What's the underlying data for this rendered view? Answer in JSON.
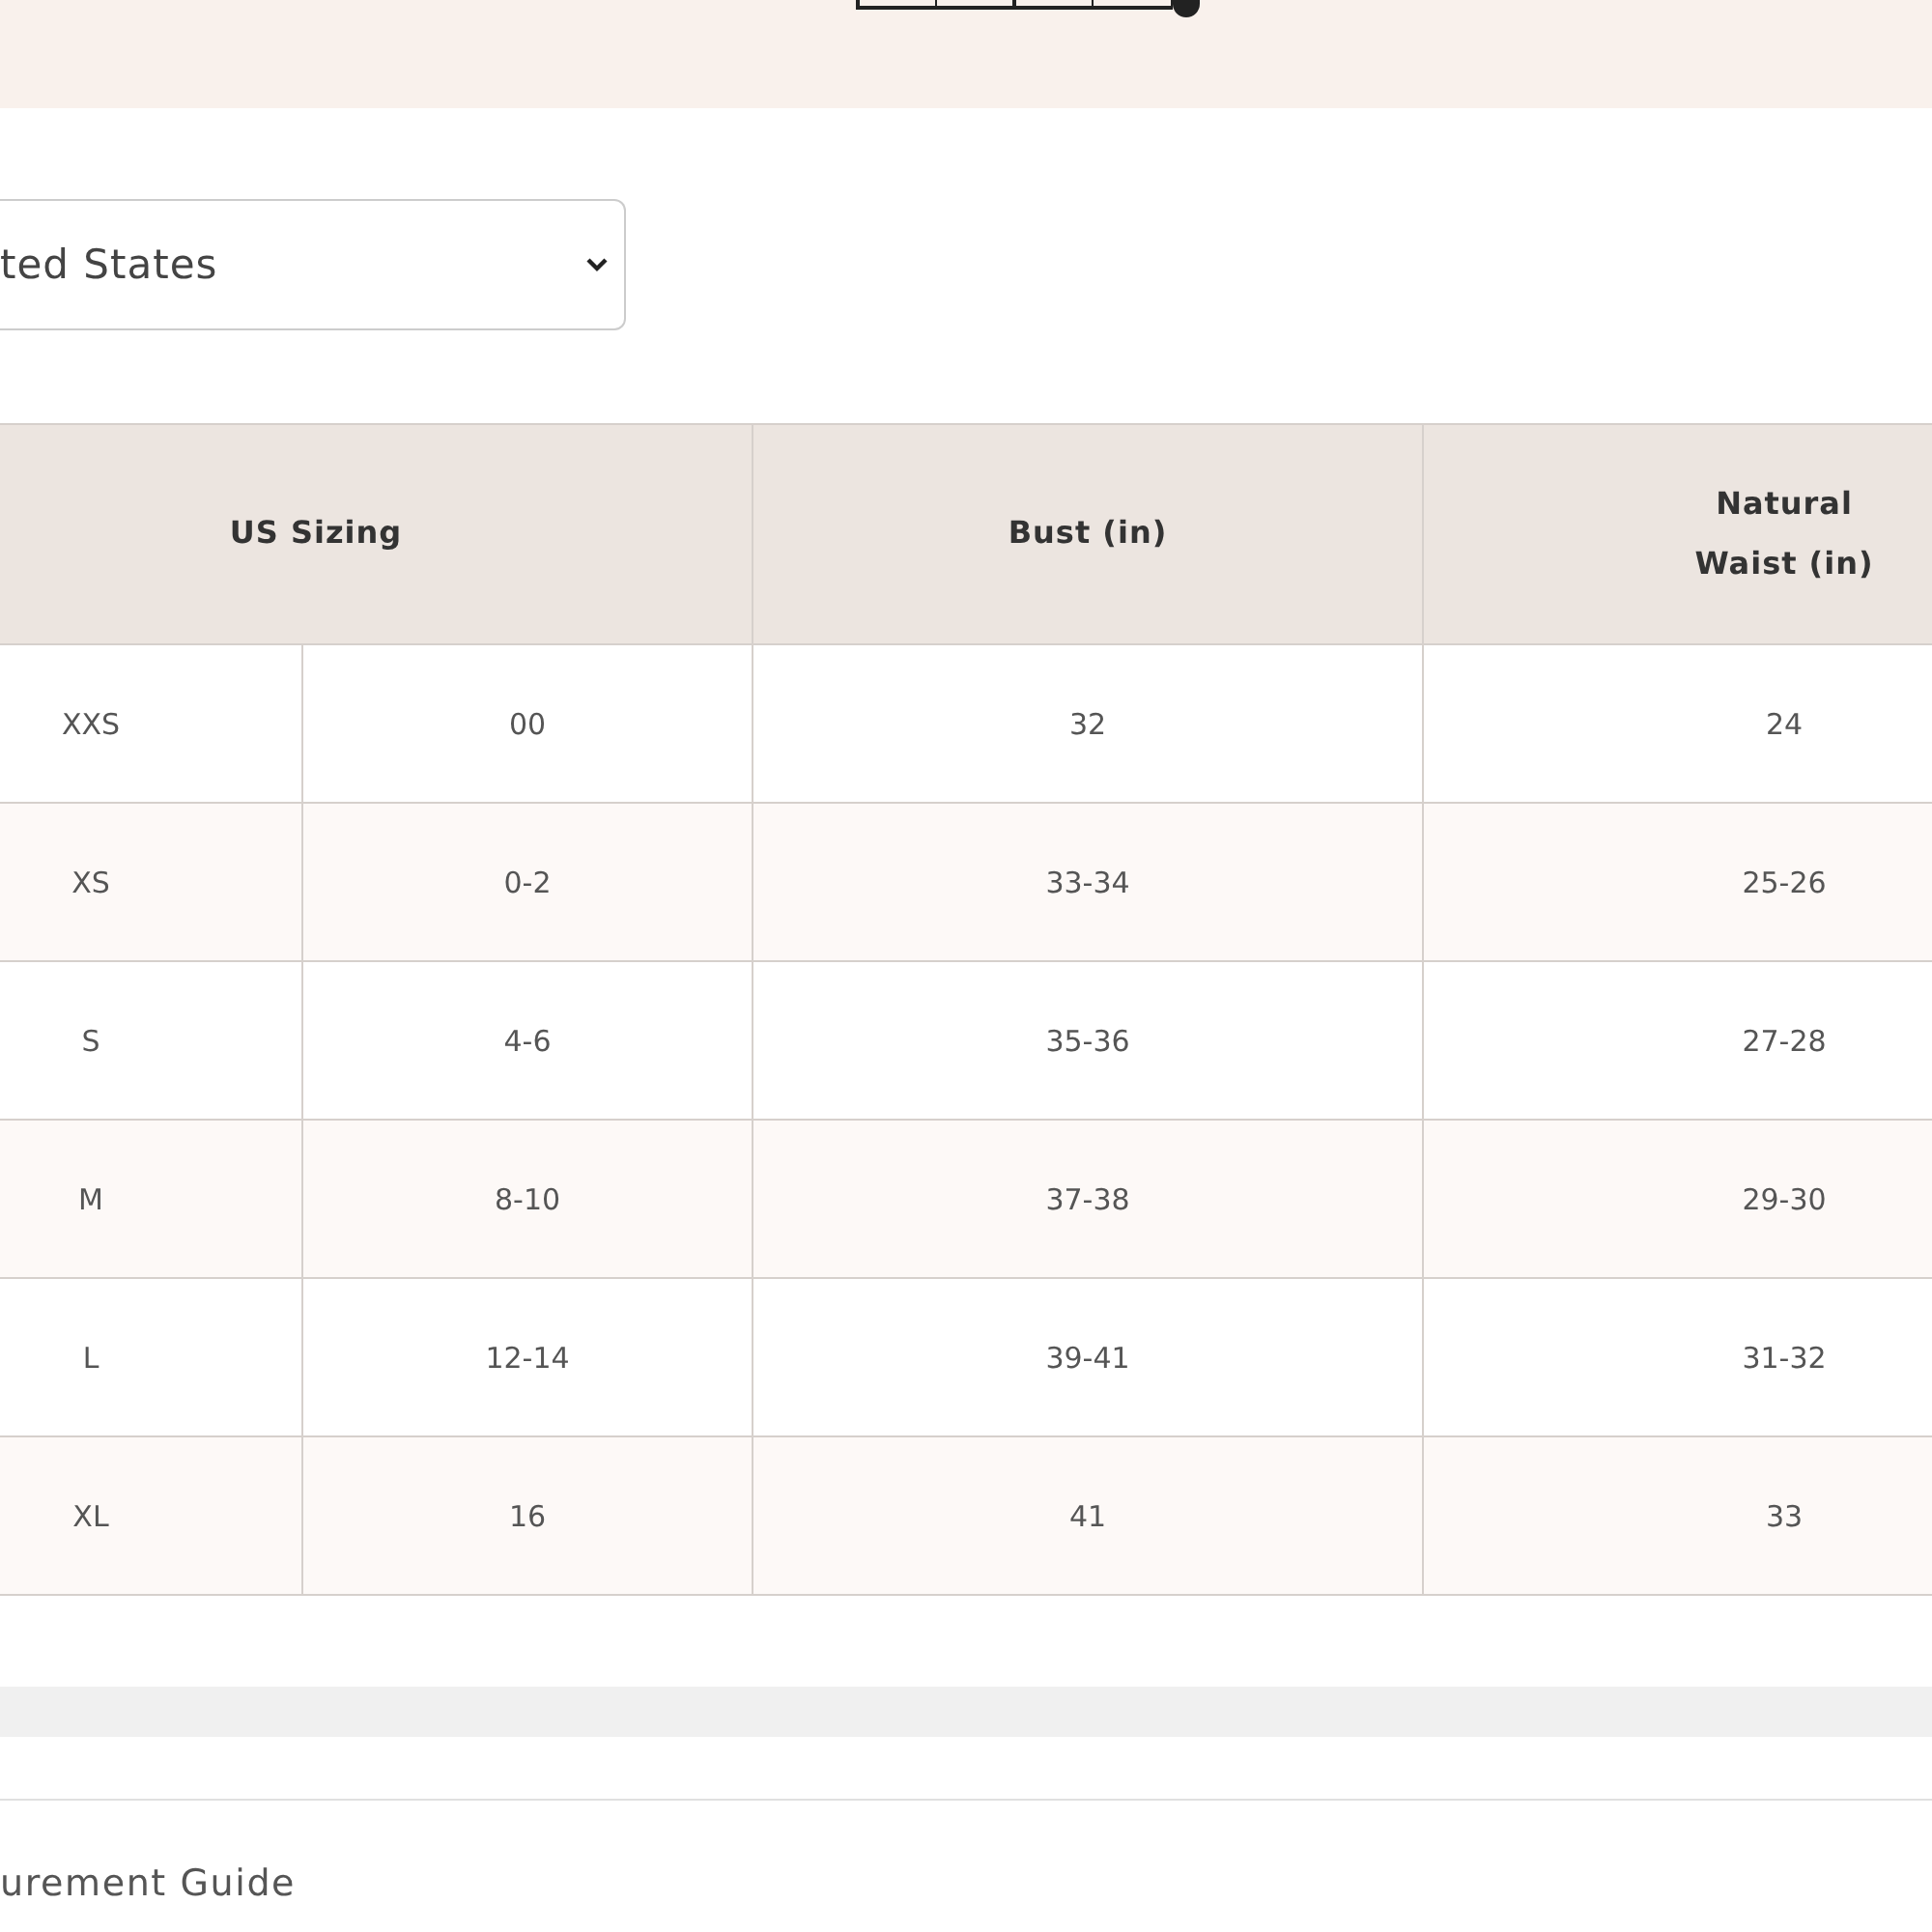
{
  "scale_slider": {
    "level": 1
  },
  "country_select": {
    "value": "ted States"
  },
  "size_table": {
    "columns": [
      {
        "label": "US Sizing",
        "colspan": 2
      },
      {
        "label": "Bust (in)"
      },
      {
        "label": "Natural Waist (in)"
      }
    ],
    "rows": [
      [
        "XXS",
        "00",
        "32",
        "24"
      ],
      [
        "XS",
        "0-2",
        "33-34",
        "25-26"
      ],
      [
        "S",
        "4-6",
        "35-36",
        "27-28"
      ],
      [
        "M",
        "8-10",
        "37-38",
        "29-30"
      ],
      [
        "L",
        "12-14",
        "39-41",
        "31-32"
      ],
      [
        "XL",
        "16",
        "41",
        "33"
      ]
    ]
  },
  "guide_link": "urement Guide"
}
